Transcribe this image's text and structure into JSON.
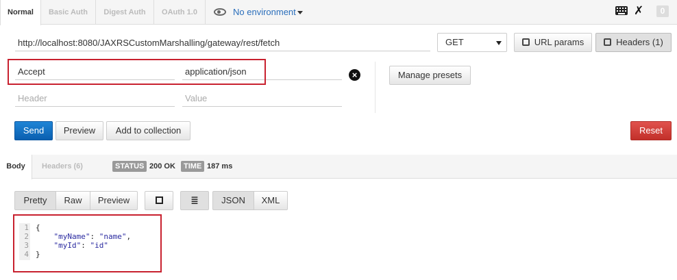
{
  "auth_tabs": [
    {
      "label": "Normal",
      "active": true
    },
    {
      "label": "Basic Auth",
      "active": false
    },
    {
      "label": "Digest Auth",
      "active": false
    },
    {
      "label": "OAuth 1.0",
      "active": false
    }
  ],
  "environment": {
    "label": "No environment"
  },
  "toolbar": {
    "count": "0"
  },
  "request": {
    "url": "http://localhost:8080/JAXRSCustomMarshalling/gateway/rest/fetch",
    "method": "GET",
    "url_params_label": "URL params",
    "headers_label": "Headers (1)"
  },
  "headers": {
    "rows": [
      {
        "key": "Accept",
        "value": "application/json"
      }
    ],
    "new_key_placeholder": "Header",
    "new_value_placeholder": "Value",
    "manage_presets_label": "Manage presets"
  },
  "actions": {
    "send": "Send",
    "preview": "Preview",
    "add_to_collection": "Add to collection",
    "reset": "Reset"
  },
  "response": {
    "tabs": [
      {
        "label": "Body",
        "active": true
      },
      {
        "label": "Headers (6)",
        "active": false
      }
    ],
    "status_label": "STATUS",
    "status_value": "200 OK",
    "time_label": "TIME",
    "time_value": "187 ms",
    "view_modes": [
      "Pretty",
      "Raw",
      "Preview"
    ],
    "active_view": "Pretty",
    "formats": [
      "JSON",
      "XML"
    ],
    "active_format": "JSON",
    "body_lines": [
      {
        "num": "1",
        "text": "{"
      },
      {
        "num": "2",
        "key": "\"myName\"",
        "value": "\"name\"",
        "trail": ","
      },
      {
        "num": "3",
        "key": "\"myId\"",
        "value": "\"id\"",
        "trail": ""
      },
      {
        "num": "4",
        "text": "}"
      }
    ]
  },
  "colors": {
    "accent_blue": "#0a5fb0",
    "reset_red": "#c2302a",
    "highlight_red": "#c8202e",
    "link_blue": "#2a6ebb"
  }
}
